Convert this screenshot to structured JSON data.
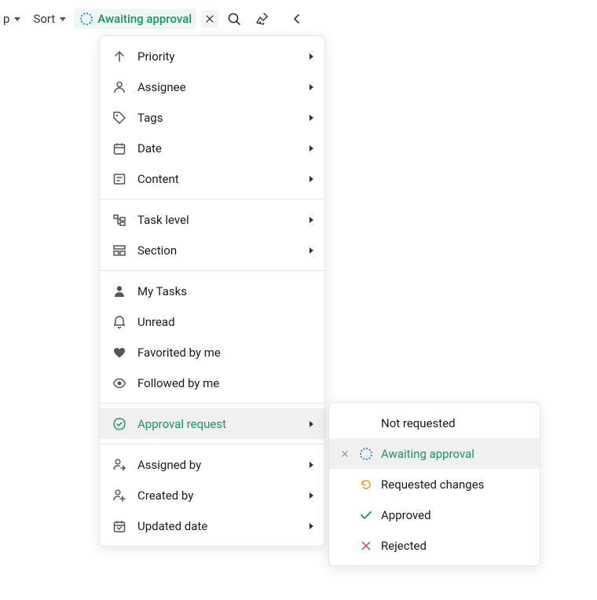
{
  "toolbar": {
    "truncated_label": "p",
    "sort_label": "Sort",
    "active_filter": "Awaiting approval"
  },
  "menu": {
    "groups": [
      [
        {
          "icon": "arrow-up",
          "label": "Priority",
          "arrow": true
        },
        {
          "icon": "person",
          "label": "Assignee",
          "arrow": true
        },
        {
          "icon": "tag",
          "label": "Tags",
          "arrow": true
        },
        {
          "icon": "calendar",
          "label": "Date",
          "arrow": true
        },
        {
          "icon": "content",
          "label": "Content",
          "arrow": true
        }
      ],
      [
        {
          "icon": "task-level",
          "label": "Task level",
          "arrow": true
        },
        {
          "icon": "section",
          "label": "Section",
          "arrow": true
        }
      ],
      [
        {
          "icon": "person-solid",
          "label": "My Tasks",
          "arrow": false
        },
        {
          "icon": "bell",
          "label": "Unread",
          "arrow": false
        },
        {
          "icon": "heart",
          "label": "Favorited by me",
          "arrow": false
        },
        {
          "icon": "eye",
          "label": "Followed by me",
          "arrow": false
        }
      ],
      [
        {
          "icon": "approval",
          "label": "Approval request",
          "arrow": true,
          "active": true
        }
      ],
      [
        {
          "icon": "assigned-by",
          "label": "Assigned by",
          "arrow": true
        },
        {
          "icon": "created-by",
          "label": "Created by",
          "arrow": true
        },
        {
          "icon": "updated-date",
          "label": "Updated date",
          "arrow": true
        }
      ]
    ]
  },
  "submenu": {
    "items": [
      {
        "label": "Not requested",
        "icon": null,
        "selected": false
      },
      {
        "label": "Awaiting approval",
        "icon": "dotted-circle",
        "selected": true
      },
      {
        "label": "Requested changes",
        "icon": "undo",
        "selected": false
      },
      {
        "label": "Approved",
        "icon": "check-green",
        "selected": false
      },
      {
        "label": "Rejected",
        "icon": "x-red",
        "selected": false
      }
    ]
  }
}
